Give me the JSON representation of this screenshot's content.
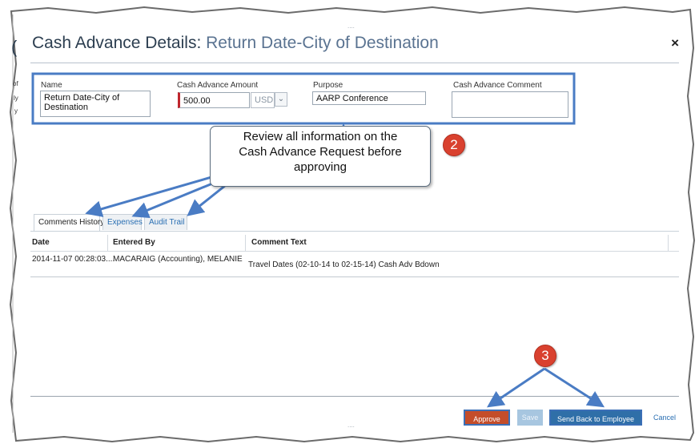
{
  "dialog": {
    "title_main": "Cash Advance Details:",
    "title_sub": "Return Date-City of Destination",
    "close_label": "×"
  },
  "form": {
    "name_label": "Name",
    "name_value_line1": "Return Date-City of",
    "name_value_line2": "Destination",
    "amount_label": "Cash Advance Amount",
    "amount_value": "500.00",
    "currency_value": "USD",
    "purpose_label": "Purpose",
    "purpose_value": "AARP Conference",
    "comment_label": "Cash Advance Comment",
    "comment_value": ""
  },
  "tabs": [
    {
      "label": "Comments History",
      "active": true
    },
    {
      "label": "Expenses",
      "active": false
    },
    {
      "label": "Audit Trail",
      "active": false
    }
  ],
  "grid": {
    "headers": [
      "Date",
      "Entered By",
      "Comment Text"
    ],
    "rows": [
      [
        "2014-11-07 00:28:03....",
        "MACARAIG (Accounting), MELANIE",
        "Travel Dates (02-10-14 to 02-15-14) Cash Adv Bdown"
      ]
    ]
  },
  "footer": {
    "approve_label": "Approve",
    "save_label": "Save",
    "send_back_label": "Send Back to Employee",
    "cancel_label": "Cancel"
  },
  "annotations": {
    "callout_text_line1": "Review all information on the",
    "callout_text_line2": "Cash Advance Request before",
    "callout_text_line3": "approving",
    "badge_2": "2",
    "badge_3": "3",
    "accent_color": "#4a7cc4",
    "badge_color": "#d9412f"
  },
  "left_edge_fragments": [
    "(",
    "of",
    "ly",
    "y"
  ],
  "handle_marks": [
    "....",
    "...."
  ]
}
